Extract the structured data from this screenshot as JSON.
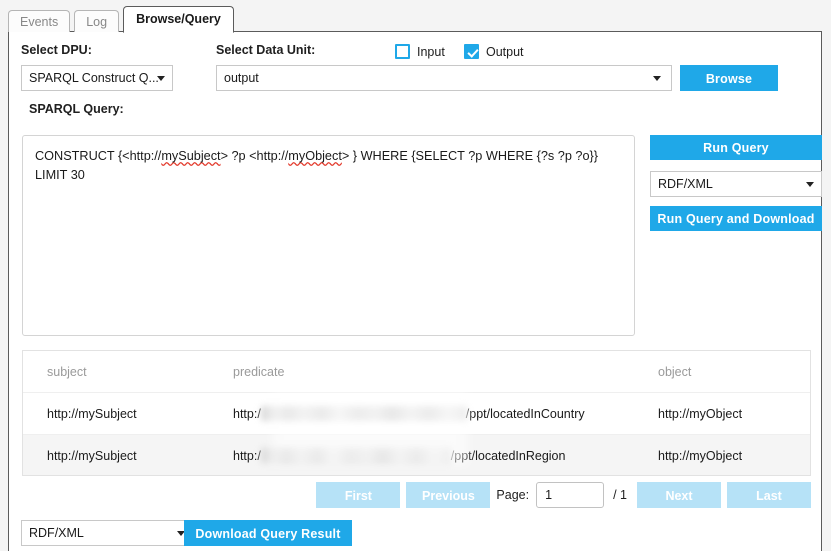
{
  "tabs": [
    {
      "label": "Events",
      "active": false
    },
    {
      "label": "Log",
      "active": false
    },
    {
      "label": "Browse/Query",
      "active": true
    }
  ],
  "form": {
    "dpu_label": "Select DPU:",
    "dpu_value": "SPARQL Construct Q...",
    "unit_label": "Select Data Unit:",
    "unit_value": "output",
    "input_checkbox_label": "Input",
    "input_checked": false,
    "output_checkbox_label": "Output",
    "output_checked": true,
    "browse_label": "Browse"
  },
  "query": {
    "label": "SPARQL Query:",
    "line1_pre": "CONSTRUCT {<http://",
    "line1_spell1": "mySubject",
    "line1_mid": "> ?p <http://",
    "line1_spell2": "myObject",
    "line1_post": "> } WHERE {SELECT ?p WHERE {?s ?p ?o}}",
    "line2": "LIMIT 30",
    "run_label": "Run Query",
    "format_value": "RDF/XML",
    "run_download_label": "Run Query and Download"
  },
  "results": {
    "columns": [
      "subject",
      "predicate",
      "object"
    ],
    "rows": [
      {
        "subject": "http://mySubject",
        "predicate_prefix": "http:/",
        "predicate_redacted": true,
        "predicate_suffix": "/ppt/locatedInCountry",
        "object": "http://myObject"
      },
      {
        "subject": "http://mySubject",
        "predicate_prefix": "http:/",
        "predicate_redacted": true,
        "predicate_suffix": "/ppt/locatedInRegion",
        "object": "http://myObject"
      }
    ]
  },
  "pager": {
    "first_label": "First",
    "previous_label": "Previous",
    "page_label": "Page:",
    "page_value": "1",
    "total_pages": "/ 1",
    "next_label": "Next",
    "last_label": "Last"
  },
  "download": {
    "format_value": "RDF/XML",
    "button_label": "Download Query Result"
  },
  "colors": {
    "accent": "#1fa8e8",
    "accent_disabled": "#b6e2f7",
    "panel_bg": "#ffffff",
    "page_bg": "#f4f4f4",
    "row_alt_bg": "#f5f5f5",
    "header_text": "#9a9a9a"
  }
}
